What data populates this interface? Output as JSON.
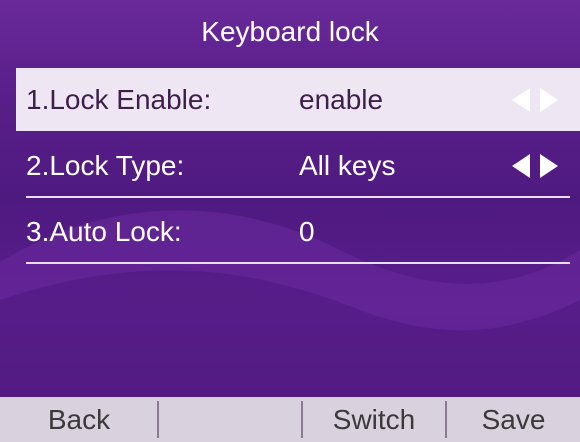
{
  "title": "Keyboard lock",
  "rows": [
    {
      "label": "1.Lock Enable:",
      "value": "enable",
      "arrows_icon": "left-right-arrows-icon",
      "arrow_color": "#ffffff"
    },
    {
      "label": "2.Lock Type:",
      "value": "All keys",
      "arrows_icon": "left-right-arrows-icon",
      "arrow_color": "#ffffff"
    },
    {
      "label": "3.Auto Lock:",
      "value": "0"
    }
  ],
  "softkeys": {
    "back": "Back",
    "blank": "",
    "switch": "Switch",
    "save": "Save"
  },
  "colors": {
    "background_purple": "#5a1f8a",
    "selected_row": "#efe6f3",
    "softkey_bar": "#d9d1dd"
  }
}
